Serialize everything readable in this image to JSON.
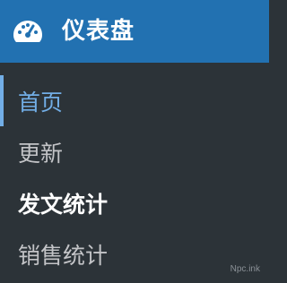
{
  "header": {
    "icon": "dashboard-gauge-icon",
    "title": "仪表盘"
  },
  "submenu": {
    "items": [
      {
        "label": "首页",
        "state": "current"
      },
      {
        "label": "更新",
        "state": "normal"
      },
      {
        "label": "发文统计",
        "state": "bold"
      },
      {
        "label": "销售统计",
        "state": "normal"
      }
    ]
  },
  "watermark": "Npc.ink",
  "colors": {
    "header_bg": "#2271b1",
    "menu_bg": "#2c3338",
    "current_item": "#72aee6",
    "normal_item": "#c3c4c7",
    "bold_item": "#ffffff"
  }
}
